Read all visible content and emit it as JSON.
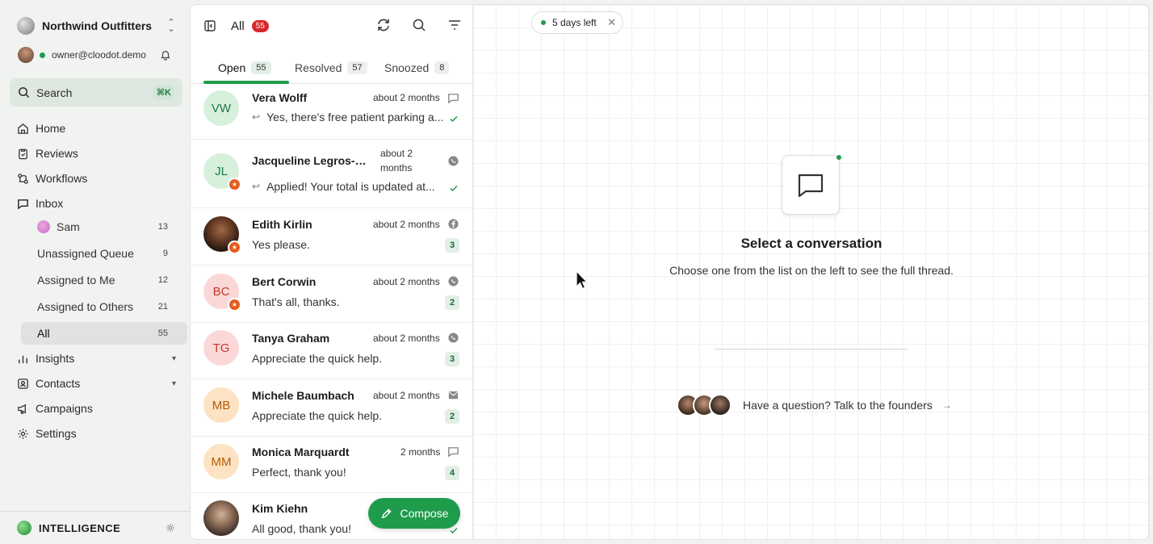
{
  "workspace": {
    "name": "Northwind Outfitters"
  },
  "user": {
    "email": "owner@cloodot.demo"
  },
  "search": {
    "label": "Search",
    "shortcut": "⌘K"
  },
  "nav": {
    "home": "Home",
    "reviews": "Reviews",
    "workflows": "Workflows",
    "inbox": "Inbox",
    "inbox_sub": [
      {
        "label": "Sam",
        "count": "13"
      },
      {
        "label": "Unassigned Queue",
        "count": "9"
      },
      {
        "label": "Assigned to Me",
        "count": "12"
      },
      {
        "label": "Assigned to Others",
        "count": "21"
      },
      {
        "label": "All",
        "count": "55"
      }
    ],
    "insights": "Insights",
    "contacts": "Contacts",
    "campaigns": "Campaigns",
    "settings": "Settings"
  },
  "footer": {
    "intelligence": "INTELLIGENCE"
  },
  "list": {
    "title": "All",
    "badge": "55",
    "tabs": [
      {
        "label": "Open",
        "count": "55"
      },
      {
        "label": "Resolved",
        "count": "57"
      },
      {
        "label": "Snoozed",
        "count": "8"
      }
    ],
    "conversations": [
      {
        "initials": "VW",
        "name": "Vera Wolff",
        "time": "about 2 months",
        "message": "Yes, there's free patient parking a...",
        "channel": "chat-icon",
        "status": "read"
      },
      {
        "initials": "JL",
        "name": "Jacqueline Legros-Mu...",
        "time_line1": "about 2",
        "time_line2": "months",
        "message": "Applied! Your total is updated at...",
        "channel": "whatsapp-icon",
        "status": "read"
      },
      {
        "initials": "",
        "name": "Edith Kirlin",
        "time": "about 2 months",
        "message": "Yes please.",
        "channel": "facebook-icon",
        "count": "3"
      },
      {
        "initials": "BC",
        "name": "Bert Corwin",
        "time": "about 2 months",
        "message": "That's all, thanks.",
        "channel": "whatsapp-icon",
        "count": "2"
      },
      {
        "initials": "TG",
        "name": "Tanya Graham",
        "time": "about 2 months",
        "message": "Appreciate the quick help.",
        "channel": "whatsapp-icon",
        "count": "3"
      },
      {
        "initials": "MB",
        "name": "Michele Baumbach",
        "time": "about 2 months",
        "message": "Appreciate the quick help.",
        "channel": "email-icon",
        "count": "2"
      },
      {
        "initials": "MM",
        "name": "Monica Marquardt",
        "time": "2 months",
        "message": "Perfect, thank you!",
        "channel": "chat-icon",
        "count": "4"
      },
      {
        "initials": "",
        "name": "Kim Kiehn",
        "time": "",
        "message": "All good, thank you!",
        "channel": "",
        "status": "read"
      }
    ],
    "compose": "Compose"
  },
  "main": {
    "trial": "5 days left",
    "empty_title": "Select a conversation",
    "empty_subtitle": "Choose one from the list on the left to see the full thread.",
    "founders": "Have a question? Talk to the founders"
  },
  "colors": {
    "accent": "#1f9b4c",
    "badge": "#d9262a",
    "star": "#e55b1a"
  }
}
